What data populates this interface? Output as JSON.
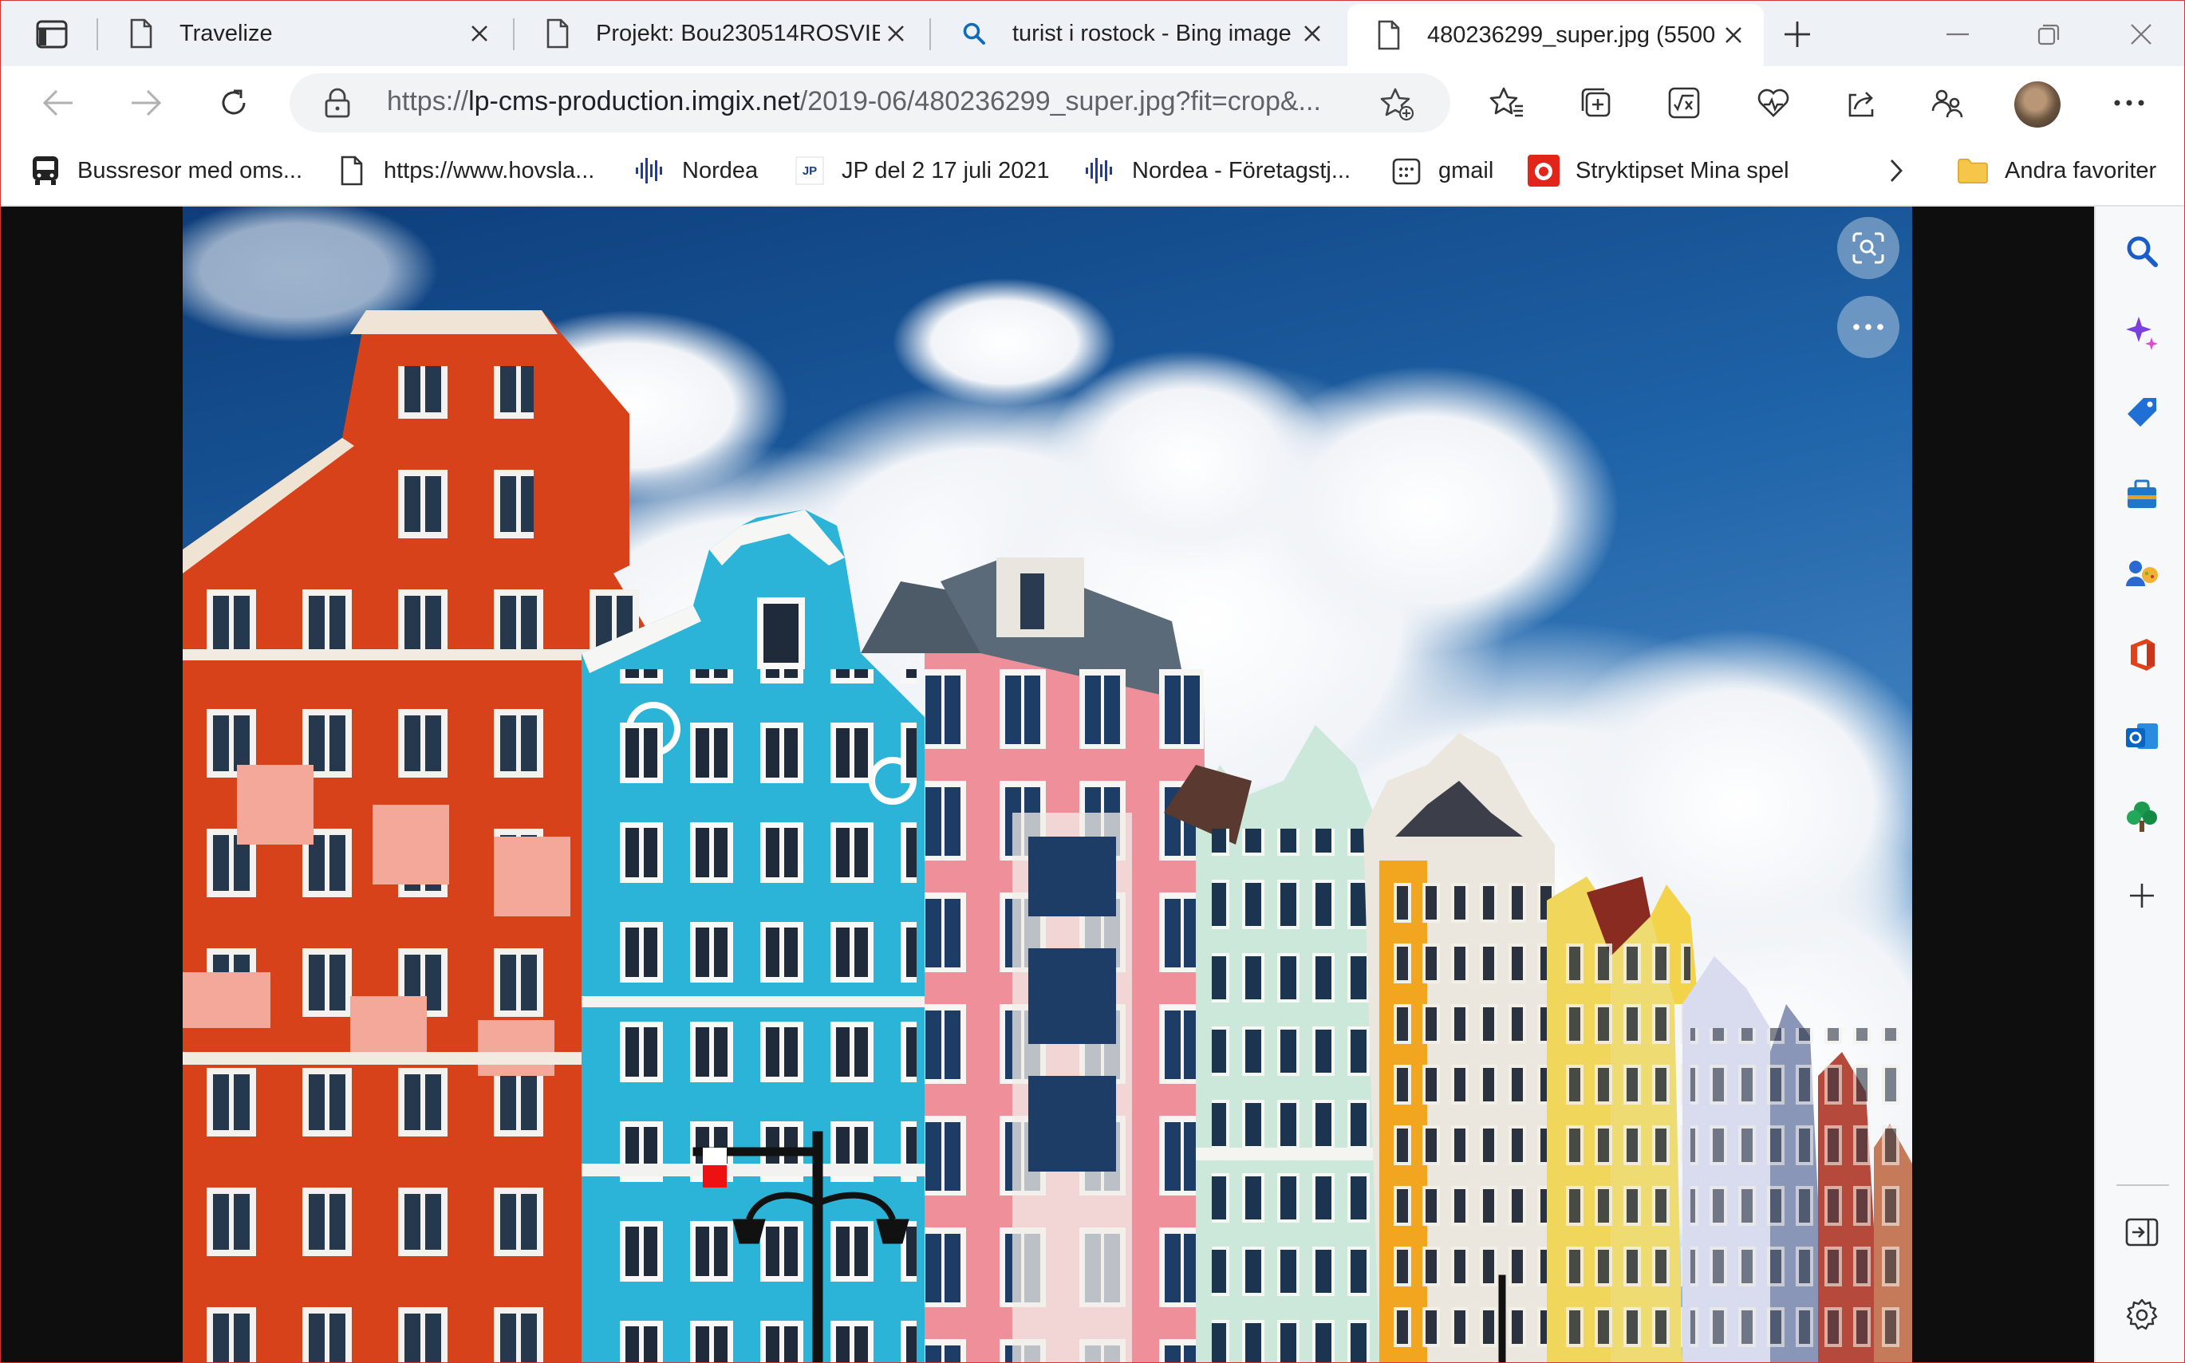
{
  "tabs": [
    {
      "title": "Travelize",
      "icon": "page-icon",
      "active": false
    },
    {
      "title": "Projekt: Bou230514ROSVIE",
      "icon": "page-icon",
      "active": false
    },
    {
      "title": "turist i rostock - Bing image",
      "icon": "bing-search-icon",
      "active": false
    },
    {
      "title": "480236299_super.jpg (5500",
      "icon": "page-icon",
      "active": true
    }
  ],
  "address": {
    "protocol": "https://",
    "host": "lp-cms-production.imgix.net",
    "path": "/2019-06/480236299_super.jpg?fit=crop&..."
  },
  "favorites": [
    {
      "label": "Bussresor med oms...",
      "icon": "bus-icon"
    },
    {
      "label": "https://www.hovsla...",
      "icon": "page-icon"
    },
    {
      "label": "Nordea",
      "icon": "nordea-icon"
    },
    {
      "label": "JP del 2 17 juli 2021",
      "icon": "jp-icon"
    },
    {
      "label": "Nordea - Företagstj...",
      "icon": "nordea-icon"
    },
    {
      "label": "gmail",
      "icon": "calendar-icon"
    },
    {
      "label": "Stryktipset Mina spel",
      "icon": "svenska-spel-icon"
    }
  ],
  "other_favorites": "Andra favoriter",
  "colors": {
    "accent": "#0f6cbd",
    "window_border": "#d03838",
    "tabstrip_bg": "#eef1f5",
    "sky_blue": "#1c62a6"
  },
  "sidebar_icons": [
    "search-icon",
    "copilot-icon",
    "shopping-tag-icon",
    "tools-icon",
    "games-icon",
    "office-icon",
    "outlook-icon",
    "tree-icon",
    "add-icon",
    "split-screen-icon",
    "settings-icon"
  ]
}
